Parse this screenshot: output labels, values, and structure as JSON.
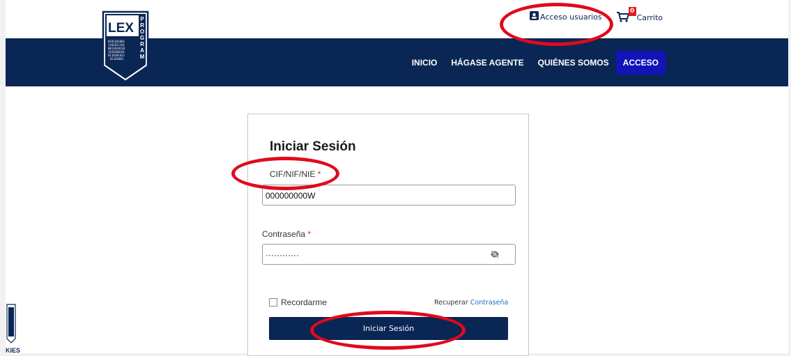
{
  "logo": {
    "brand": "LEX",
    "brand_vertical": "PROGRAM",
    "binary_text": "0101101001\n1101011101\n0011010110\n1010100101"
  },
  "header": {
    "acceso_usuarios": "Acceso usuarios",
    "carrito_label": "Carrito",
    "cart_count": "0"
  },
  "nav": {
    "items": [
      "INICIO",
      "HÁGASE AGENTE",
      "QUIÉNES SOMOS",
      "ACCESO"
    ],
    "active_index": 3
  },
  "login": {
    "title": "Iniciar Sesión",
    "id_label": "CIF/NIF/NIE",
    "id_value": "000000000W",
    "password_label": "Contraseña",
    "password_value": "············",
    "required_mark": "*",
    "remember_label": "Recordarme",
    "recover_prefix": "Recuperar ",
    "recover_link": "Contraseña",
    "submit_label": "Iniciar Sesión"
  },
  "cookies": {
    "label": "KIES"
  },
  "colors": {
    "navy": "#0a2654",
    "active": "#1313b8",
    "accent_red": "#e00a1c",
    "link": "#1a6ec1"
  }
}
